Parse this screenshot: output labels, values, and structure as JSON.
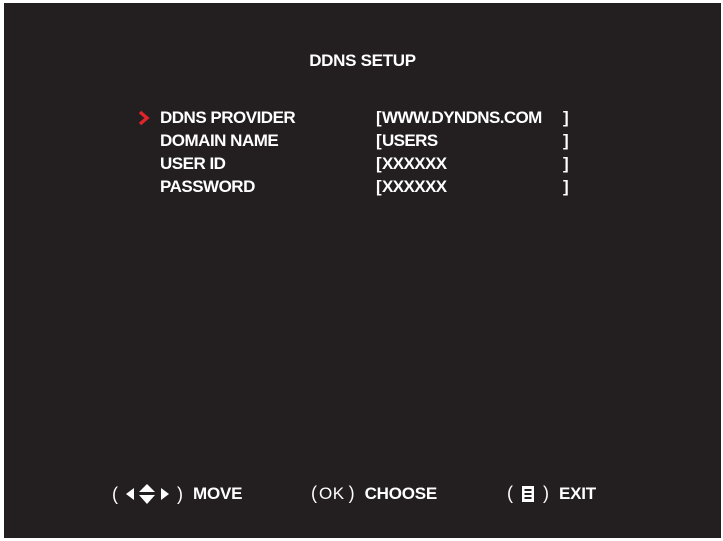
{
  "screen": {
    "title": "DDNS SETUP",
    "background_color": "#231f20",
    "cursor_color": "#e0252a"
  },
  "menu": {
    "selected_index": 0,
    "items": [
      {
        "label": "DDNS PROVIDER",
        "open": "[",
        "value": "WWW.DYNDNS.COM",
        "close": "]"
      },
      {
        "label": "DOMAIN NAME",
        "open": "[",
        "value": "USERS",
        "close": "]"
      },
      {
        "label": "USER ID",
        "open": "[",
        "value": "XXXXXX",
        "close": "]"
      },
      {
        "label": "PASSWORD",
        "open": "[",
        "value": "XXXXXX",
        "close": "]"
      }
    ]
  },
  "footer": {
    "move": {
      "open": "(",
      "close": ")",
      "label": "MOVE",
      "icons": [
        "arrow-left-icon",
        "arrow-up-down-icon",
        "arrow-right-icon"
      ]
    },
    "choose": {
      "open": "(",
      "key": "OK",
      "close": ")",
      "label": "CHOOSE"
    },
    "exit": {
      "open": "(",
      "close": ")",
      "label": "EXIT",
      "icons": [
        "menu-key-icon"
      ]
    }
  }
}
